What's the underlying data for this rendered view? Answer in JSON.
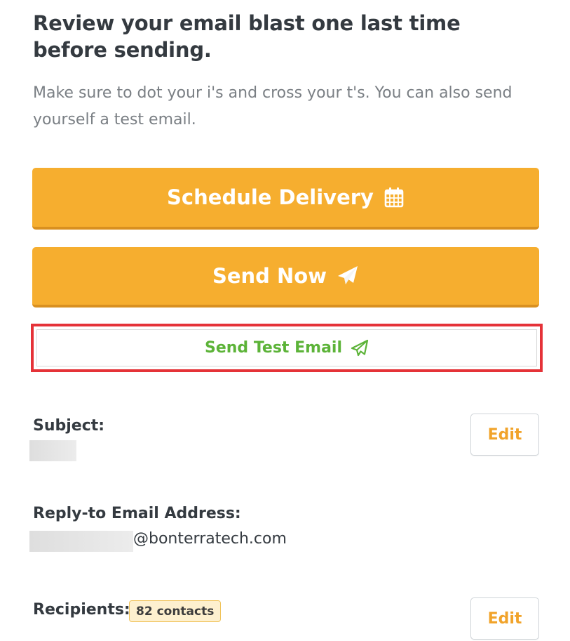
{
  "header": {
    "title": "Review your email blast one last time before sending.",
    "subtitle": "Make sure to dot your i's and cross your t's. You can also send yourself a test email."
  },
  "actions": {
    "schedule_label": "Schedule Delivery",
    "schedule_icon": "calendar-icon",
    "send_now_label": "Send Now",
    "send_now_icon": "paper-plane-icon",
    "send_test_label": "Send Test Email",
    "send_test_icon": "paper-plane-outline-icon"
  },
  "subject": {
    "label": "Subject:",
    "edit_label": "Edit"
  },
  "reply_to": {
    "label": "Reply-to Email Address:",
    "domain": "@bonterratech.com"
  },
  "recipients": {
    "label": "Recipients:",
    "count_badge": "82 contacts",
    "edit_label": "Edit"
  },
  "colors": {
    "primary": "#f6ae2f",
    "success": "#5cb338",
    "highlight": "#e53238",
    "badge_bg": "#fdf0cf"
  }
}
